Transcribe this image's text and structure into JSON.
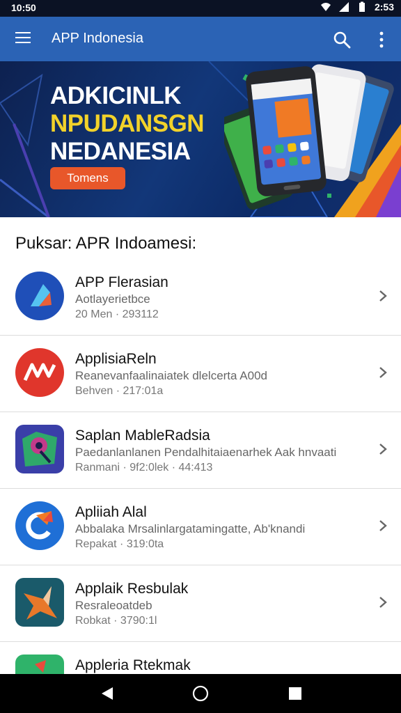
{
  "status_bar": {
    "time_left": "10:50",
    "time_right": "2:53"
  },
  "app_bar": {
    "title": "APP Indonesia"
  },
  "banner": {
    "line1": "ADKICINLK",
    "line2": "NPUDANSGN",
    "line3": "NEDANESIA",
    "button_label": "Tomens"
  },
  "section": {
    "title": "Puksar: APR Indoamesi:"
  },
  "apps": [
    {
      "name": "APP Flerasian",
      "desc": "Aotlayerietbce",
      "meta": "20 Men · 293112",
      "icon": "blue-a-icon"
    },
    {
      "name": "ApplisiaReln",
      "desc": "Reanevanfaalinaiatek dlelcerta A00d",
      "meta": "Behven · 217:01a",
      "icon": "red-logo-icon"
    },
    {
      "name": "Saplan MableRadsia",
      "desc": "Paedanlanlanen Pendalhitaiaenarhek Aak hnvaati",
      "meta": "Ranmani · 9f2:0lek · 44:413",
      "icon": "purple-map-icon"
    },
    {
      "name": "Apliiah Alal",
      "desc": "Abbalaka Mrsalinlargatamingatte, Ab'knandi",
      "meta": "Repakat · 319:0ta",
      "icon": "blue-c-icon"
    },
    {
      "name": "Applaik Resbulak",
      "desc": "Resraleoatdeb",
      "meta": "Robkat · 3790:1l",
      "icon": "orange-star-icon"
    },
    {
      "name": "Appleria Rtekmak",
      "desc": "",
      "meta": "",
      "icon": "green-app-icon"
    }
  ],
  "colors": {
    "app_bar": "#2b63b5",
    "banner_button": "#e8572a",
    "banner_accent": "#f2d22a"
  }
}
